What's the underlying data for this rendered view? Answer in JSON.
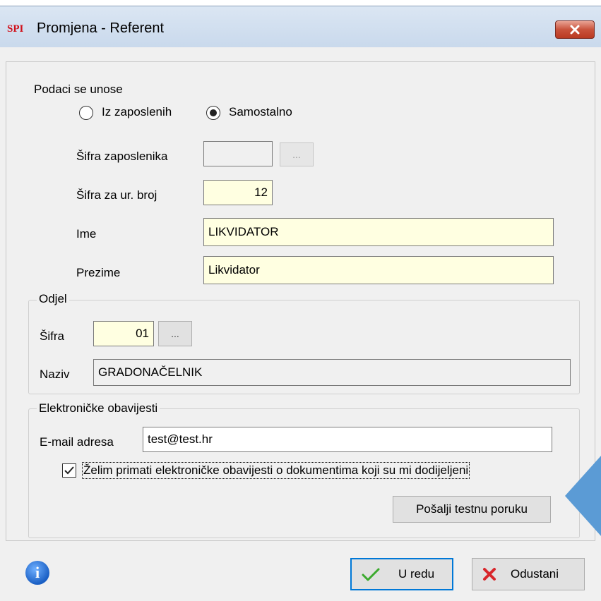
{
  "window": {
    "logo": "SPI",
    "title": "Promjena - Referent",
    "close_glyph": "✕"
  },
  "entry": {
    "label": "Podaci se unose",
    "options": [
      {
        "label": "Iz zaposlenih",
        "checked": false
      },
      {
        "label": "Samostalno",
        "checked": true
      }
    ]
  },
  "employee_code": {
    "label": "Šifra zaposlenika",
    "value": "",
    "browse_label": "..."
  },
  "reg_code": {
    "label": "Šifra za ur. broj",
    "value": "12"
  },
  "first_name": {
    "label": "Ime",
    "value": "LIKVIDATOR"
  },
  "last_name": {
    "label": "Prezime",
    "value": "Likvidator"
  },
  "department": {
    "legend": "Odjel",
    "code_label": "Šifra",
    "code_value": "01",
    "browse_label": "...",
    "name_label": "Naziv",
    "name_value": "GRADONAČELNIK"
  },
  "notifications": {
    "legend": "Elektroničke obavijesti",
    "email_label": "E-mail adresa",
    "email_value": "test@test.hr",
    "checkbox_label": "Želim primati elektroničke obavijesti o dokumentima koji su mi dodijeljeni",
    "checkbox_checked": true,
    "test_button": "Pošalji testnu poruku"
  },
  "footer": {
    "info_glyph": "i",
    "ok_label": "U redu",
    "cancel_label": "Odustani"
  },
  "colors": {
    "accent": "#0078d7",
    "required_field": "#ffffe1",
    "annotation_arrow": "#5b9bd5",
    "close_button": "#c9523b"
  }
}
